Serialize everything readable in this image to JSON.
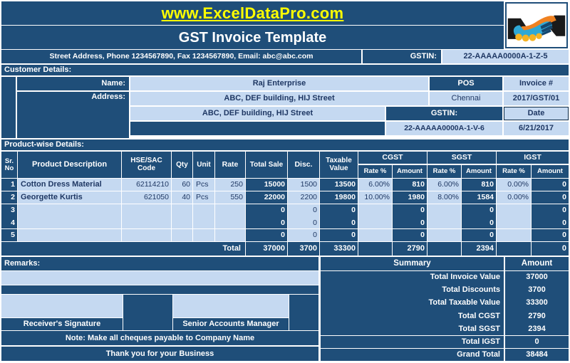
{
  "header": {
    "brand": "www.ExcelDataPro.com",
    "title": "GST Invoice Template",
    "address_line": "Street Address, Phone 1234567890, Fax 1234567890, Email: abc@abc.com",
    "gstin_label": "GSTIN:",
    "gstin_value": "22-AAAAA0000A-1-Z-5",
    "logo_name": "handshake-logo"
  },
  "customer": {
    "section_label": "Customer Details:",
    "name_label": "Name:",
    "name_value": "Raj Enterprise",
    "address_label": "Address:",
    "address_line1": "ABC, DEF building, HIJ Street",
    "address_line2": "ABC, DEF building, HIJ Street",
    "address_line3": "",
    "pos_label": "POS",
    "pos_value": "Chennai",
    "invoice_no_label": "Invoice #",
    "invoice_no_value": "2017/GST/01",
    "gstin_label": "GSTIN:",
    "gstin_value": "22-AAAAA0000A-1-V-6",
    "date_label": "Date",
    "date_value": "6/21/2017"
  },
  "products": {
    "section_label": "Product-wise Details:",
    "headers": {
      "sr_no": "Sr. No",
      "sr_no_l1": "Sr.",
      "sr_no_l2": "No",
      "description": "Product Description",
      "hsn_l1": "HSE/SAC",
      "hsn_l2": "Code",
      "qty": "Qty",
      "unit": "Unit",
      "rate": "Rate",
      "total_sale": "Total Sale",
      "disc": "Disc.",
      "taxable_l1": "Taxable",
      "taxable_l2": "Value",
      "cgst": "CGST",
      "sgst": "SGST",
      "igst": "IGST",
      "rate_pct": "Rate %",
      "amount": "Amount"
    },
    "rows": [
      {
        "sr": "1",
        "description": "Cotton Dress Material",
        "hsn": "62114210",
        "qty": "60",
        "unit": "Pcs",
        "rate": "250",
        "total_sale": "15000",
        "disc": "1500",
        "taxable": "13500",
        "cgst_rate": "6.00%",
        "cgst_amt": "810",
        "sgst_rate": "6.00%",
        "sgst_amt": "810",
        "igst_rate": "0.00%",
        "igst_amt": "0"
      },
      {
        "sr": "2",
        "description": "Georgette Kurtis",
        "hsn": "621050",
        "qty": "40",
        "unit": "Pcs",
        "rate": "550",
        "total_sale": "22000",
        "disc": "2200",
        "taxable": "19800",
        "cgst_rate": "10.00%",
        "cgst_amt": "1980",
        "sgst_rate": "8.00%",
        "sgst_amt": "1584",
        "igst_rate": "0.00%",
        "igst_amt": "0"
      },
      {
        "sr": "3",
        "description": "",
        "hsn": "",
        "qty": "",
        "unit": "",
        "rate": "",
        "total_sale": "0",
        "disc": "0",
        "taxable": "0",
        "cgst_rate": "",
        "cgst_amt": "0",
        "sgst_rate": "",
        "sgst_amt": "0",
        "igst_rate": "",
        "igst_amt": "0"
      },
      {
        "sr": "4",
        "description": "",
        "hsn": "",
        "qty": "",
        "unit": "",
        "rate": "",
        "total_sale": "0",
        "disc": "0",
        "taxable": "0",
        "cgst_rate": "",
        "cgst_amt": "0",
        "sgst_rate": "",
        "sgst_amt": "0",
        "igst_rate": "",
        "igst_amt": "0"
      },
      {
        "sr": "5",
        "description": "",
        "hsn": "",
        "qty": "",
        "unit": "",
        "rate": "",
        "total_sale": "0",
        "disc": "0",
        "taxable": "0",
        "cgst_rate": "",
        "cgst_amt": "0",
        "sgst_rate": "",
        "sgst_amt": "0",
        "igst_rate": "",
        "igst_amt": "0"
      }
    ],
    "total": {
      "label": "Total",
      "total_sale": "37000",
      "disc": "3700",
      "taxable": "33300",
      "cgst_rate": "",
      "cgst_amt": "2790",
      "sgst_rate": "",
      "sgst_amt": "2394",
      "igst_rate": "",
      "igst_amt": "0"
    }
  },
  "remarks": {
    "label": "Remarks:",
    "value": ""
  },
  "signatures": {
    "receiver": "Receiver's Signature",
    "manager": "Senior Accounts Manager"
  },
  "footer": {
    "note": "Note: Make all cheques payable to Company Name",
    "thanks": "Thank you for your Business"
  },
  "summary": {
    "title": "Summary",
    "amount_header": "Amount",
    "rows": [
      {
        "label": "Total Invoice Value",
        "value": "37000"
      },
      {
        "label": "Total Discounts",
        "value": "3700"
      },
      {
        "label": "Total Taxable Value",
        "value": "33300"
      },
      {
        "label": "Total CGST",
        "value": "2790"
      },
      {
        "label": "Total SGST",
        "value": "2394"
      },
      {
        "label": "Total IGST",
        "value": "0"
      },
      {
        "label": "Grand Total",
        "value": "38484"
      }
    ]
  },
  "colors": {
    "dark_navy": "#1f4e79",
    "light_blue": "#c5d9f1",
    "accent_yellow": "#ffff00",
    "text_dark": "#1f3864"
  }
}
